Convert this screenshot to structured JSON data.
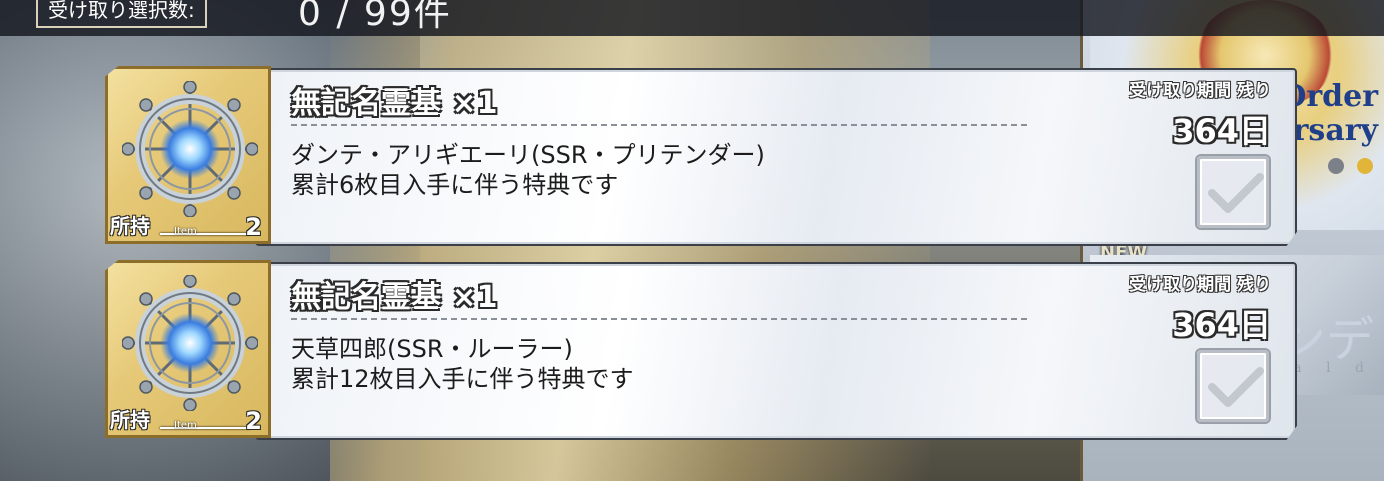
{
  "header": {
    "selection_label": "受け取り選択数:",
    "selection_count": "0 /   99件"
  },
  "background": {
    "banner_top_text_line1": "Order",
    "banner_top_text_line2": "ersary",
    "new_tag": "NEW",
    "banner_bottom_text": "ンデ",
    "banner_bottom_sub": "a l d"
  },
  "items": [
    {
      "icon": "ship-wheel-icon",
      "name": "無記名霊基 ×1",
      "description_line1": "ダンテ・アリギエーリ(SSR・プリテンダー)",
      "description_line2": "累計6枚目入手に伴う特典です",
      "owned_label": "所持",
      "item_tag": "Item",
      "owned_count": "2",
      "period_label": "受け取り期間 残り",
      "days_remaining": "364日",
      "selected": false
    },
    {
      "icon": "ship-wheel-icon",
      "name": "無記名霊基 ×1",
      "description_line1": "天草四郎(SSR・ルーラー)",
      "description_line2": "累計12枚目入手に伴う特典です",
      "owned_label": "所持",
      "item_tag": "Item",
      "owned_count": "2",
      "period_label": "受け取り期間 残り",
      "days_remaining": "364日",
      "selected": false
    }
  ],
  "colors": {
    "topbar": "#14161e",
    "icon_frame_gold": "#e6c978",
    "icon_frame_border": "#8d6d2a",
    "dot_gray": "#7c8088",
    "dot_gold": "#e0b53a"
  }
}
